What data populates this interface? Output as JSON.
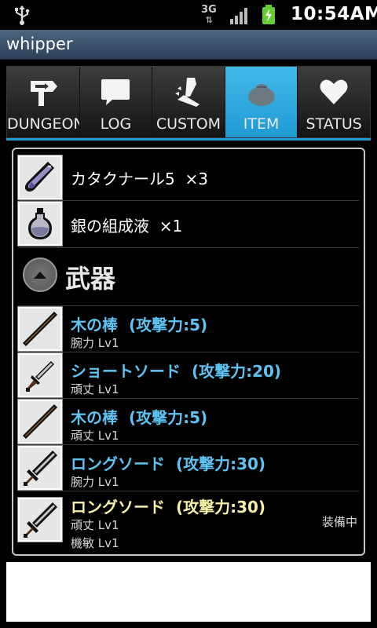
{
  "status_bar": {
    "network": "3G",
    "time": "10:54AM",
    "icons": [
      "usb-icon",
      "signal-icon",
      "battery-charging-icon"
    ]
  },
  "app": {
    "title": "whipper"
  },
  "tabs": [
    {
      "label": "DUNGEON",
      "icon": "signpost-icon"
    },
    {
      "label": "LOG",
      "icon": "speech-bubble-icon"
    },
    {
      "label": "CUSTOM",
      "icon": "hammer-icon"
    },
    {
      "label": "ITEM",
      "icon": "bag-icon",
      "active": true
    },
    {
      "label": "STATUS",
      "icon": "heart-icon"
    }
  ],
  "items": [
    {
      "name": "カタクナール5",
      "count": "×3",
      "icon": "potion-tube-icon"
    },
    {
      "name": "銀の組成液",
      "count": "×1",
      "icon": "flask-icon"
    }
  ],
  "section": {
    "title": "武器",
    "icon": "collapse-arrow-icon"
  },
  "weapons": [
    {
      "name": "木の棒",
      "attack": "(攻撃力:5)",
      "stats": [
        "腕力 Lv1"
      ],
      "color": "#5ec4f4",
      "icon": "stick-icon"
    },
    {
      "name": "ショートソード",
      "attack": "(攻撃力:20)",
      "stats": [
        "頑丈 Lv1"
      ],
      "color": "#5ec4f4",
      "icon": "dagger-icon"
    },
    {
      "name": "木の棒",
      "attack": "(攻撃力:5)",
      "stats": [
        "頑丈 Lv1"
      ],
      "color": "#5ec4f4",
      "icon": "stick-icon"
    },
    {
      "name": "ロングソード",
      "attack": "(攻撃力:30)",
      "stats": [
        "腕力 Lv1"
      ],
      "color": "#5ec4f4",
      "icon": "sword-icon"
    },
    {
      "name": "ロングソード",
      "attack": "(攻撃力:30)",
      "stats": [
        "頑丈 Lv1",
        "機敏 Lv1"
      ],
      "color": "#f8f0a8",
      "icon": "sword-icon",
      "equipped": "装備中"
    }
  ]
}
